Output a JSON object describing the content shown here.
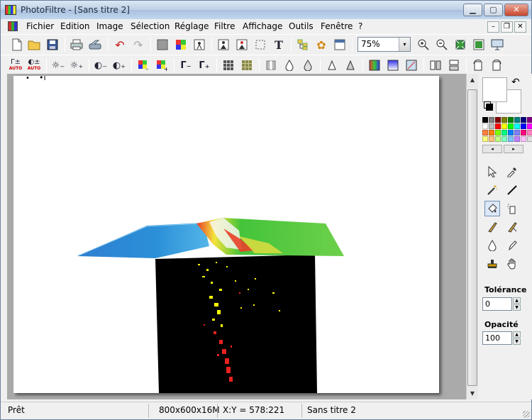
{
  "window": {
    "title": "PhotoFiltre - [Sans titre 2]",
    "minimize": "▁",
    "maximize": "▢",
    "close": "✕"
  },
  "menubar": {
    "items": [
      "Fichier",
      "Edition",
      "Image",
      "Sélection",
      "Réglage",
      "Filtre",
      "Affichage",
      "Outils",
      "Fenêtre",
      "?"
    ],
    "mdi_minimize": "–",
    "mdi_restore": "❐",
    "mdi_close": "✕"
  },
  "toolbar1": {
    "icons": [
      "new-file-icon",
      "open-folder-icon",
      "save-icon",
      "print-icon",
      "scan-icon",
      "undo-icon",
      "redo-icon",
      "grayscale-icon",
      "rgb-icon",
      "transparency-icon",
      "text-icon"
    ],
    "zoom_value": "75%",
    "zoom_arrow": "▾"
  },
  "toolbar2": {
    "auto_label": "AUTO"
  },
  "tools": {
    "tolerance_label": "Tolérance",
    "tolerance_value": "0",
    "opacity_label": "Opacité",
    "opacity_value": "100"
  },
  "palette_colors": [
    "#000000",
    "#808080",
    "#800000",
    "#808000",
    "#008000",
    "#008080",
    "#000080",
    "#800080",
    "#ffffff",
    "#c0c0c0",
    "#ff0000",
    "#ffff00",
    "#00ff00",
    "#00ffff",
    "#0000ff",
    "#ff00ff",
    "#ff8040",
    "#ff8000",
    "#80ff00",
    "#00ff80",
    "#0080ff",
    "#8080ff",
    "#ff0080",
    "#ff80c0",
    "#ffff80",
    "#ffc080",
    "#c0ff80",
    "#80ffc0",
    "#80c0ff",
    "#c080ff",
    "#ffc0ff",
    "#e0e0e0"
  ],
  "statusbar": {
    "status": "Prêt",
    "image_info": "800x600x16M",
    "coords": "X:Y = 578:221",
    "doc_name": "Sans titre 2"
  },
  "accent_colors": {
    "title_gradient_top": "#dce8f5",
    "close_button": "#c8452c",
    "ocean_blue": "#2b8fd4",
    "terrain_green": "#4cbf3a",
    "block_black": "#000000"
  }
}
